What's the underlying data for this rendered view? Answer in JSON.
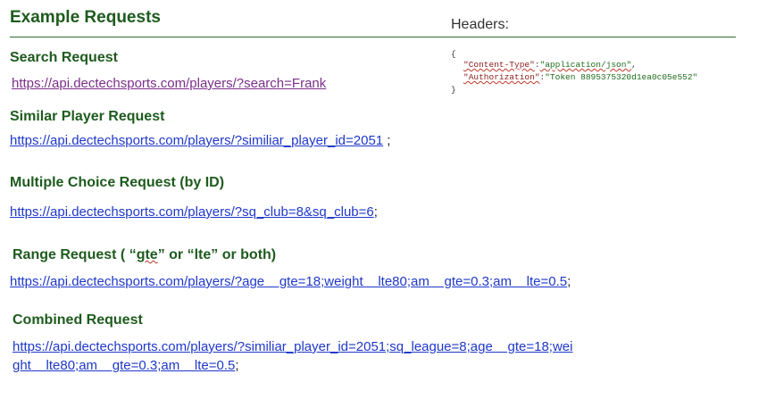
{
  "page": {
    "title": "Example Requests"
  },
  "headers_panel": {
    "title": "Headers:",
    "open_brace": "{",
    "close_brace": "}",
    "lines": [
      {
        "key": "\"Content-Type\"",
        "sep": ":",
        "value": "\"application/json\"",
        "end": ","
      },
      {
        "key": "\"Authorization\"",
        "sep": ":",
        "value": "\"Token  8895375320d1ea0c05e552\"",
        "end": ""
      }
    ]
  },
  "sections": {
    "search": {
      "heading": "Search Request",
      "url": "https://api.dectechsports.com/players/?search=Frank",
      "suffix": ""
    },
    "similar": {
      "heading": "Similar Player Request",
      "url": "https://api.dectechsports.com/players/?similiar_player_id=2051",
      "suffix": " ;"
    },
    "multiple": {
      "heading": "Multiple Choice Request (by ID)",
      "url": "https://api.dectechsports.com/players/?sq_club=8&sq_club=6",
      "suffix": ";"
    },
    "range": {
      "heading_pre": "Range Request ( “",
      "heading_gte": "gte",
      "heading_mid": "” or “lte” or both)",
      "url": "https://api.dectechsports.com/players/?age__gte=18;weight__lte80;am__gte=0.3;am__lte=0.5",
      "url_display": "https://api.dectechsports.com/players/?age    gte=18;weight    lte80;am    gte=0.3;am    lte=0.5",
      "suffix": ";"
    },
    "combined": {
      "heading": "Combined Request",
      "url_line1": "https://api.dectechsports.com/players/?similiar_player_id=2051;sq_league=8;age    gte=18;wei",
      "url_line2": "ght    lte80;am    gte=0.3;am    lte=0.5",
      "suffix": ";"
    }
  }
}
